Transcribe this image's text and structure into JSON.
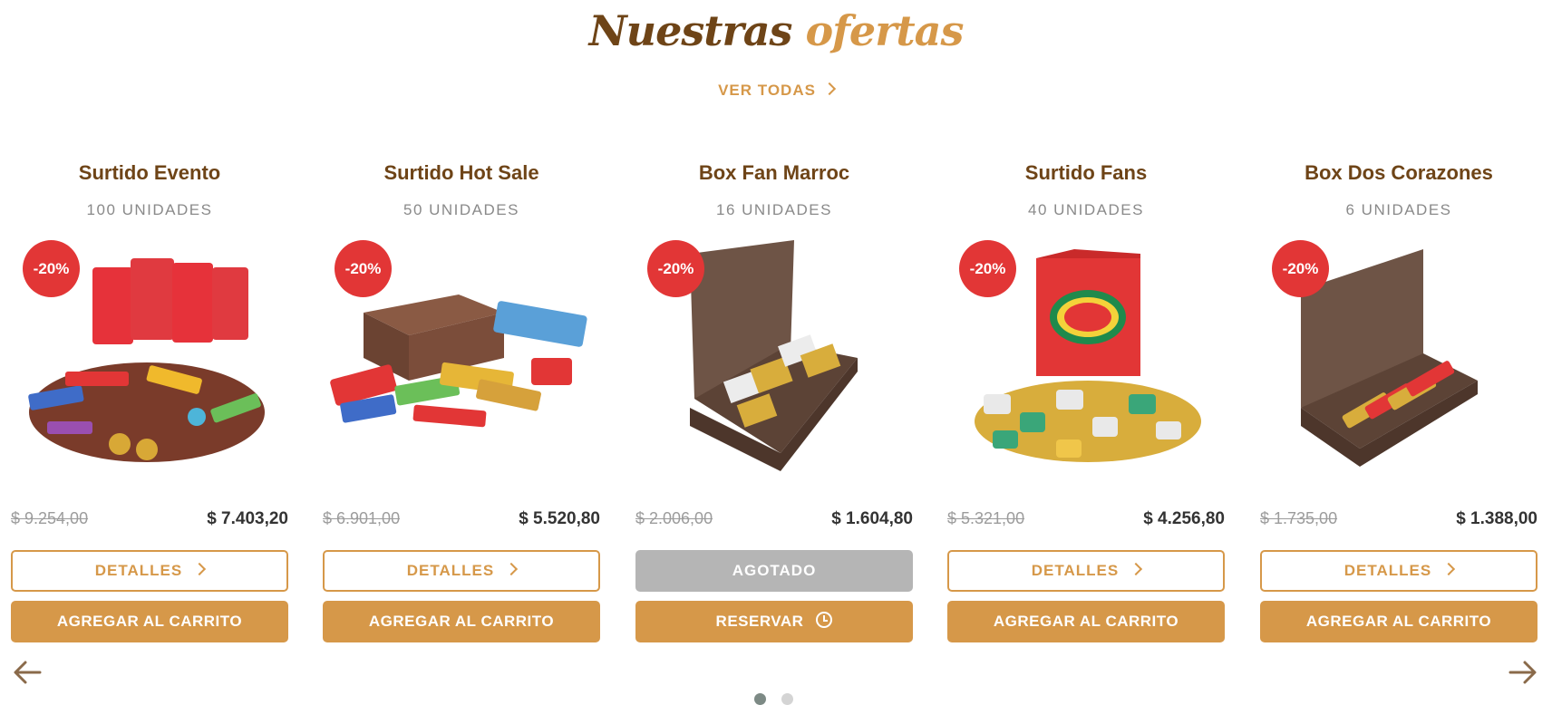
{
  "section": {
    "title_part1": "Nuestras",
    "title_part2": "ofertas",
    "view_all_label": "VER TODAS"
  },
  "colors": {
    "brown": "#6e4417",
    "gold": "#d69849",
    "badge_red": "#e23636",
    "disabled_gray": "#b5b5b5"
  },
  "products": [
    {
      "name": "Surtido Evento",
      "units": "100 UNIDADES",
      "discount": "-20%",
      "old_price": "$ 9.254,00",
      "price": "$ 7.403,20",
      "primary_button": "DETALLES",
      "secondary_button": "AGREGAR AL CARRITO"
    },
    {
      "name": "Surtido Hot Sale",
      "units": "50 UNIDADES",
      "discount": "-20%",
      "old_price": "$ 6.901,00",
      "price": "$ 5.520,80",
      "primary_button": "DETALLES",
      "secondary_button": "AGREGAR AL CARRITO"
    },
    {
      "name": "Box Fan Marroc",
      "units": "16 UNIDADES",
      "discount": "-20%",
      "old_price": "$ 2.006,00",
      "price": "$ 1.604,80",
      "primary_button": "AGOTADO",
      "secondary_button": "RESERVAR"
    },
    {
      "name": "Surtido Fans",
      "units": "40 UNIDADES",
      "discount": "-20%",
      "old_price": "$ 5.321,00",
      "price": "$ 4.256,80",
      "primary_button": "DETALLES",
      "secondary_button": "AGREGAR AL CARRITO"
    },
    {
      "name": "Box Dos Corazones",
      "units": "6 UNIDADES",
      "discount": "-20%",
      "old_price": "$ 1.735,00",
      "price": "$ 1.388,00",
      "primary_button": "DETALLES",
      "secondary_button": "AGREGAR AL CARRITO"
    }
  ],
  "carousel": {
    "prev_icon": "arrow-left-icon",
    "next_icon": "arrow-right-icon",
    "pages": 2,
    "active_page": 1
  }
}
